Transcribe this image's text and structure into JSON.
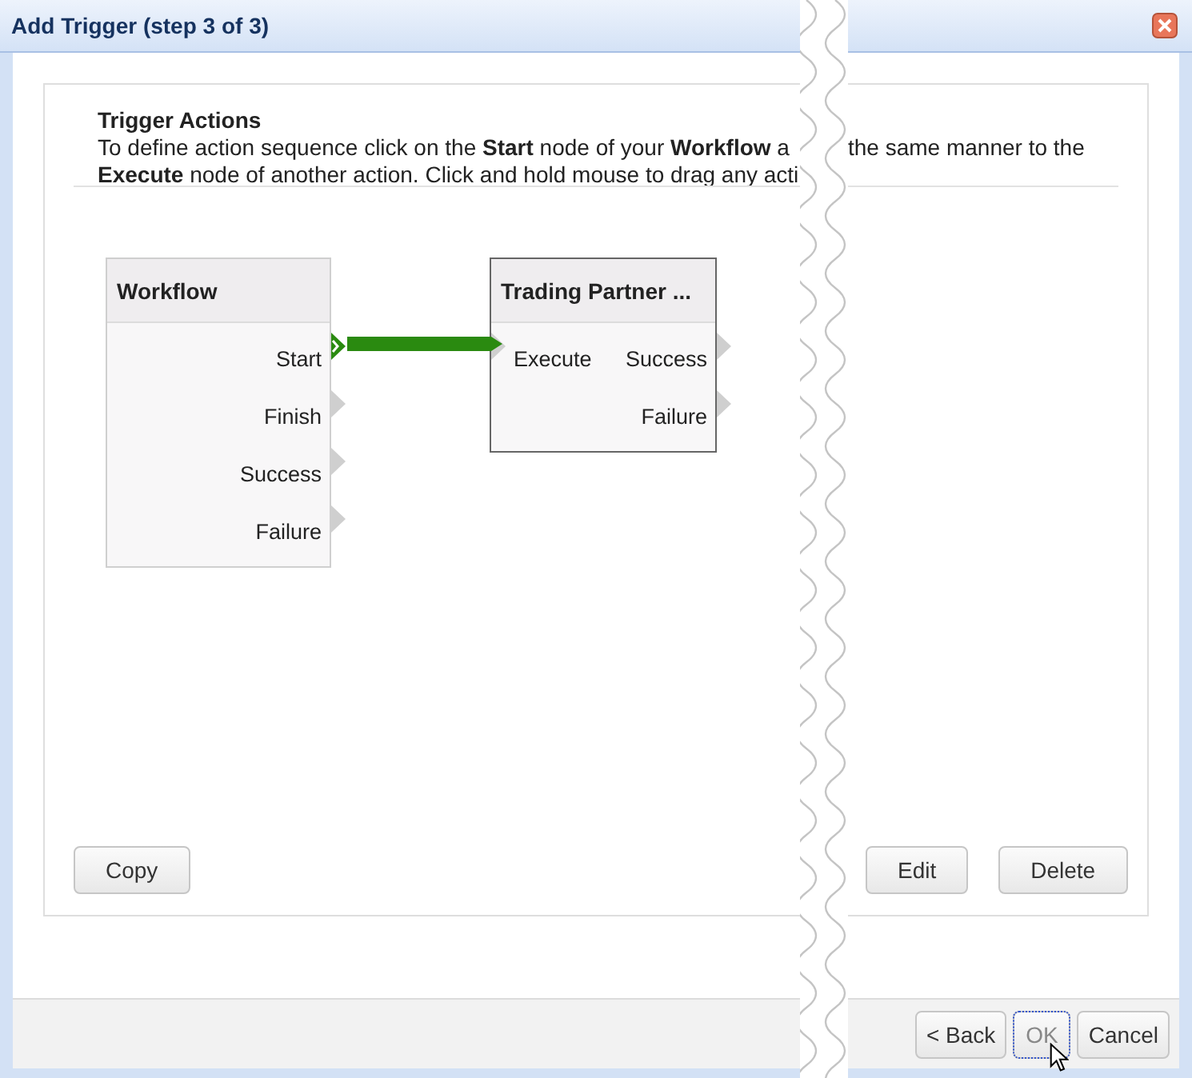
{
  "window": {
    "title": "Add Trigger (step 3 of 3)"
  },
  "panel": {
    "heading": "Trigger Actions",
    "instructions_left": [
      "To define action sequence click on the **Start** node of your **Workflow** a",
      "**Execute** node of another action. Click and hold mouse to drag any acti"
    ],
    "instructions_right": [
      "the same manner to the"
    ]
  },
  "nodes": [
    {
      "title": "Workflow",
      "outputs": [
        {
          "label": "Start",
          "connected": true
        },
        {
          "label": "Finish",
          "connected": false
        },
        {
          "label": "Success",
          "connected": false
        },
        {
          "label": "Failure",
          "connected": false
        }
      ]
    },
    {
      "title": "Trading Partner ...",
      "inputs": [
        {
          "label": "Execute",
          "connected": true
        }
      ],
      "outputs": [
        {
          "label": "Success",
          "connected": false
        },
        {
          "label": "Failure",
          "connected": false
        }
      ]
    }
  ],
  "panel_buttons_left": [
    {
      "label": "Copy"
    }
  ],
  "panel_buttons_right": [
    {
      "label": "Edit"
    },
    {
      "label": "Delete"
    }
  ],
  "footer_buttons": [
    {
      "label": "< Back",
      "disabled": false,
      "focused": false
    },
    {
      "label": "OK",
      "disabled": true,
      "focused": true
    },
    {
      "label": "Cancel",
      "disabled": false,
      "focused": false
    }
  ]
}
